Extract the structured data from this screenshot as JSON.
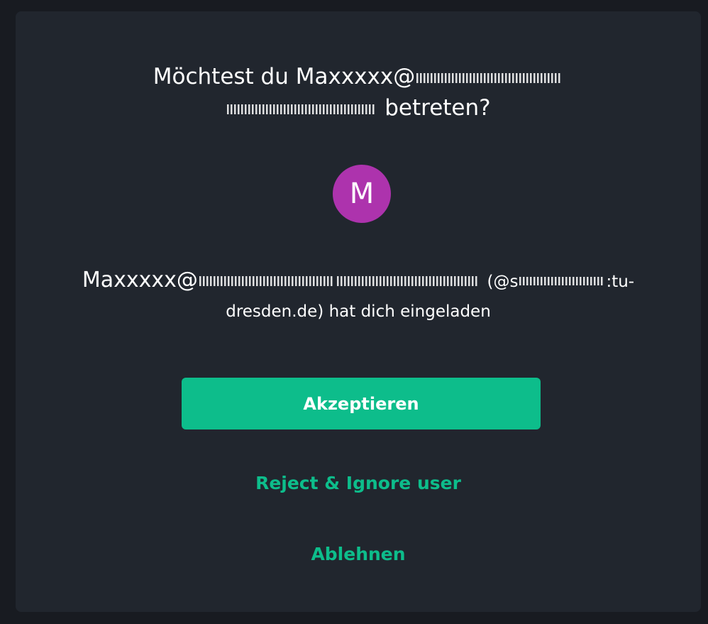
{
  "dialog": {
    "title_line1_prefix": "Möchtest du Maxxxxx@",
    "title_line2_suffix": "betreten?",
    "avatar_initial": "M",
    "inviter_name": "Maxxxxx@",
    "inviter_id_prefix": "(@s",
    "inviter_id_suffix": ":tu-",
    "inviter_line2": "dresden.de) hat dich eingeladen",
    "accept_label": "Akzeptieren",
    "reject_ignore_label": "Reject & Ignore user",
    "decline_label": "Ablehnen"
  },
  "colors": {
    "accent": "#0dbd8b",
    "avatar_bg": "#ad33ad",
    "dialog_bg": "#21262e"
  }
}
